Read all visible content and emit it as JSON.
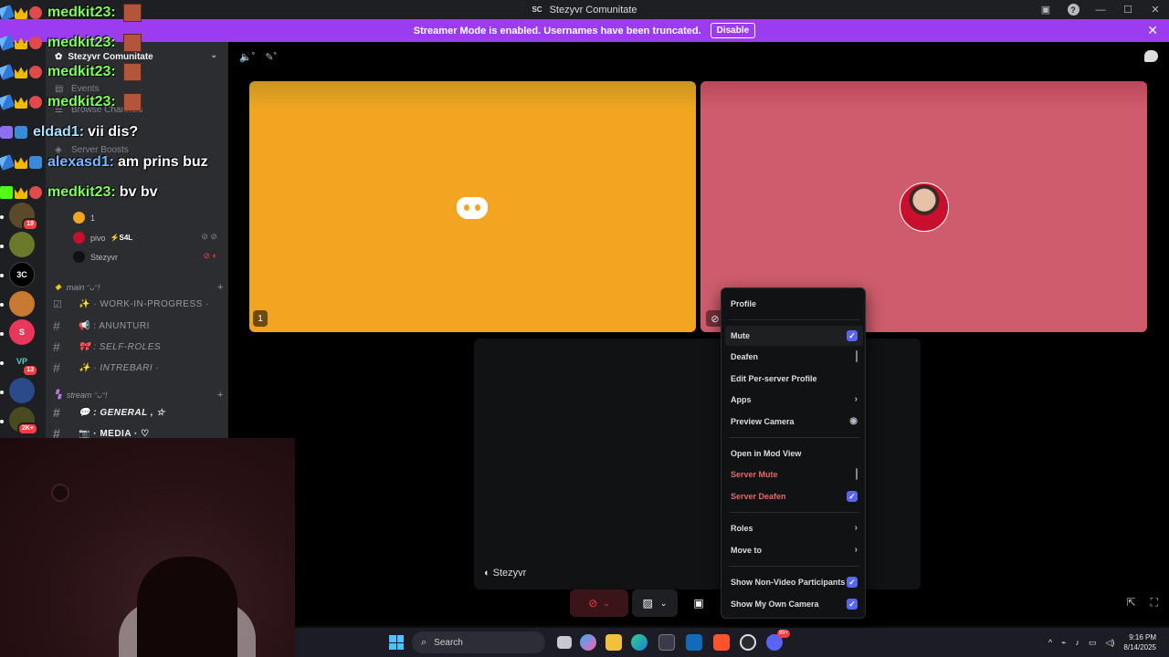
{
  "window": {
    "app_short": "SC",
    "title": "Stezyvr Comunitate"
  },
  "banner": {
    "text": "Streamer Mode is enabled. Usernames have been truncated.",
    "button": "Disable"
  },
  "rail": {
    "badges": [
      "19",
      "13",
      "2K+"
    ],
    "labels": [
      "3C",
      "VP"
    ]
  },
  "sidebar": {
    "server_name": "Stezyvr Comunitate",
    "nav": [
      "Events",
      "Browse Channels",
      "Server Boosts"
    ],
    "voice_users": [
      {
        "name": "1"
      },
      {
        "name": "pivo",
        "tag": "⚡S4L"
      },
      {
        "name": "Stezyvr"
      }
    ],
    "categories": [
      {
        "label": "main ᵔᴗᵔ!"
      },
      {
        "label": "stream ᵔᴗᵔ!"
      }
    ],
    "channels_main": [
      "✨ · WORK-IN-PROGRESS ·",
      "📢 : ANUNTURI",
      "🎀 : SELF-ROLES",
      "✨ · INTREBARI ·"
    ],
    "channels_stream": [
      "💬 : GENERAL , ☆",
      "📷 · MEDIA · ♡"
    ]
  },
  "chat": [
    {
      "name": "medkit23:",
      "text": ""
    },
    {
      "name": "medkit23:",
      "text": ""
    },
    {
      "name": "medkit23:",
      "text": ""
    },
    {
      "name": "medkit23:",
      "text": ""
    },
    {
      "name": "eldad1:",
      "text": "vii dis?"
    },
    {
      "name": "alexasd1:",
      "text": "am prins buz"
    },
    {
      "name": "medkit23:",
      "text": "bv bv"
    }
  ],
  "stage": {
    "tile_number": "1",
    "dark_tile_label": "Stezyvr",
    "accent": "#5865f2"
  },
  "menu": {
    "items": {
      "profile": "Profile",
      "mute": "Mute",
      "deafen": "Deafen",
      "edit_profile": "Edit Per-server Profile",
      "apps": "Apps",
      "preview_camera": "Preview Camera",
      "open_mod_view": "Open in Mod View",
      "server_mute": "Server Mute",
      "server_deafen": "Server Deafen",
      "roles": "Roles",
      "move_to": "Move to",
      "show_non_video": "Show Non-Video Participants",
      "show_own_camera": "Show My Own Camera"
    },
    "checked": {
      "mute": true,
      "deafen": false,
      "server_mute": false,
      "server_deafen": true,
      "show_non_video": true,
      "show_own_camera": true
    }
  },
  "taskbar": {
    "search_placeholder": "Search",
    "time": "9:16 PM",
    "date": "8/14/2025",
    "discord_badge": "99+"
  }
}
